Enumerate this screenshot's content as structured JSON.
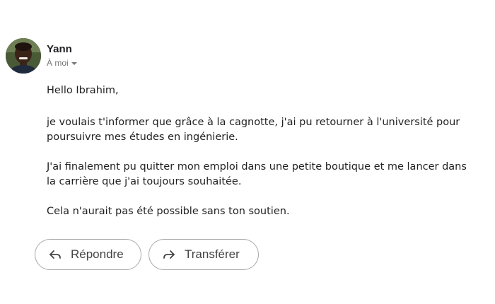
{
  "sender": {
    "name": "Yann",
    "recipient_line": "À moi",
    "avatar_icon": "user-avatar-photo"
  },
  "message": {
    "greeting": "Hello Ibrahim,",
    "paragraphs": [
      "je voulais t'informer que grâce à la cagnotte, j'ai pu retourner à l'université pour poursuivre mes études en ingénierie.",
      "J'ai finalement pu quitter mon emploi dans une petite boutique et me lancer dans la carrière que j'ai toujours souhaitée.",
      "Cela n'aurait pas été possible sans ton soutien."
    ]
  },
  "actions": {
    "reply_label": "Répondre",
    "reply_icon": "reply-arrow-icon",
    "forward_label": "Transférer",
    "forward_icon": "forward-arrow-icon"
  }
}
